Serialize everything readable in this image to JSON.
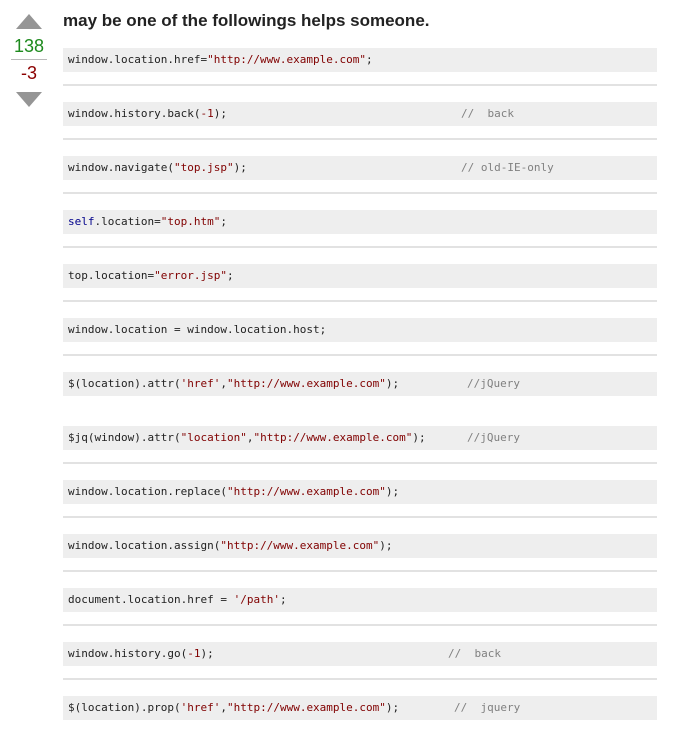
{
  "vote": {
    "upvote_label": "upvote",
    "downvote_label": "downvote",
    "up_count": "138",
    "down_count": "-3",
    "colors": {
      "up": "#1d8a1d",
      "down": "#8b0000",
      "arrow": "#959595"
    }
  },
  "answer": {
    "title": "may be one of the followings helps someone.",
    "snippets": [
      {
        "parts": [
          {
            "t": "window.location.href=",
            "c": ""
          },
          {
            "t": "\"http://www.example.com\"",
            "c": "str"
          },
          {
            "t": ";",
            "c": ""
          }
        ],
        "comment": "",
        "sep_after": true
      },
      {
        "parts": [
          {
            "t": "window.history.back(",
            "c": ""
          },
          {
            "t": "-1",
            "c": "num"
          },
          {
            "t": ");",
            "c": ""
          }
        ],
        "comment": "//  back",
        "comment_col": 398,
        "sep_after": true
      },
      {
        "parts": [
          {
            "t": "window.navigate(",
            "c": ""
          },
          {
            "t": "\"top.jsp\"",
            "c": "str"
          },
          {
            "t": ");",
            "c": ""
          }
        ],
        "comment": "// old-IE-only",
        "comment_col": 398,
        "sep_after": true
      },
      {
        "parts": [
          {
            "t": "self",
            "c": "kw"
          },
          {
            "t": ".location=",
            "c": ""
          },
          {
            "t": "\"top.htm\"",
            "c": "str"
          },
          {
            "t": ";",
            "c": ""
          }
        ],
        "comment": "",
        "sep_after": true
      },
      {
        "parts": [
          {
            "t": "top.location=",
            "c": ""
          },
          {
            "t": "\"error.jsp\"",
            "c": "str"
          },
          {
            "t": ";",
            "c": ""
          }
        ],
        "comment": "",
        "sep_after": true
      },
      {
        "parts": [
          {
            "t": "window.location = window.location.host;",
            "c": ""
          }
        ],
        "comment": "",
        "sep_after": true
      },
      {
        "parts": [
          {
            "t": "$(location).attr(",
            "c": ""
          },
          {
            "t": "'href'",
            "c": "str"
          },
          {
            "t": ",",
            "c": ""
          },
          {
            "t": "\"http://www.example.com\"",
            "c": "str"
          },
          {
            "t": ");",
            "c": ""
          }
        ],
        "comment": "//jQuery",
        "comment_col": 404,
        "sep_after": false
      },
      {
        "parts": [
          {
            "t": "$jq(window).attr(",
            "c": ""
          },
          {
            "t": "\"location\"",
            "c": "str"
          },
          {
            "t": ",",
            "c": ""
          },
          {
            "t": "\"http://www.example.com\"",
            "c": "str"
          },
          {
            "t": ");",
            "c": ""
          }
        ],
        "comment": "//jQuery",
        "comment_col": 404,
        "sep_after": true
      },
      {
        "parts": [
          {
            "t": "window.location.replace(",
            "c": ""
          },
          {
            "t": "\"http://www.example.com\"",
            "c": "str"
          },
          {
            "t": ");",
            "c": ""
          }
        ],
        "comment": "",
        "sep_after": true
      },
      {
        "parts": [
          {
            "t": "window.location.assign(",
            "c": ""
          },
          {
            "t": "\"http://www.example.com\"",
            "c": "str"
          },
          {
            "t": ");",
            "c": ""
          }
        ],
        "comment": "",
        "sep_after": true
      },
      {
        "parts": [
          {
            "t": "document.location.href = ",
            "c": ""
          },
          {
            "t": "'/path'",
            "c": "str"
          },
          {
            "t": ";",
            "c": ""
          }
        ],
        "comment": "",
        "sep_after": true
      },
      {
        "parts": [
          {
            "t": "window.history.go(",
            "c": ""
          },
          {
            "t": "-1",
            "c": "num"
          },
          {
            "t": ");",
            "c": ""
          }
        ],
        "comment": "//  back",
        "comment_col": 385,
        "sep_after": true
      },
      {
        "parts": [
          {
            "t": "$(location).prop(",
            "c": ""
          },
          {
            "t": "'href'",
            "c": "str"
          },
          {
            "t": ",",
            "c": ""
          },
          {
            "t": "\"http://www.example.com\"",
            "c": "str"
          },
          {
            "t": ");",
            "c": ""
          }
        ],
        "comment": "//  jquery",
        "comment_col": 391,
        "sep_after": false
      }
    ]
  }
}
